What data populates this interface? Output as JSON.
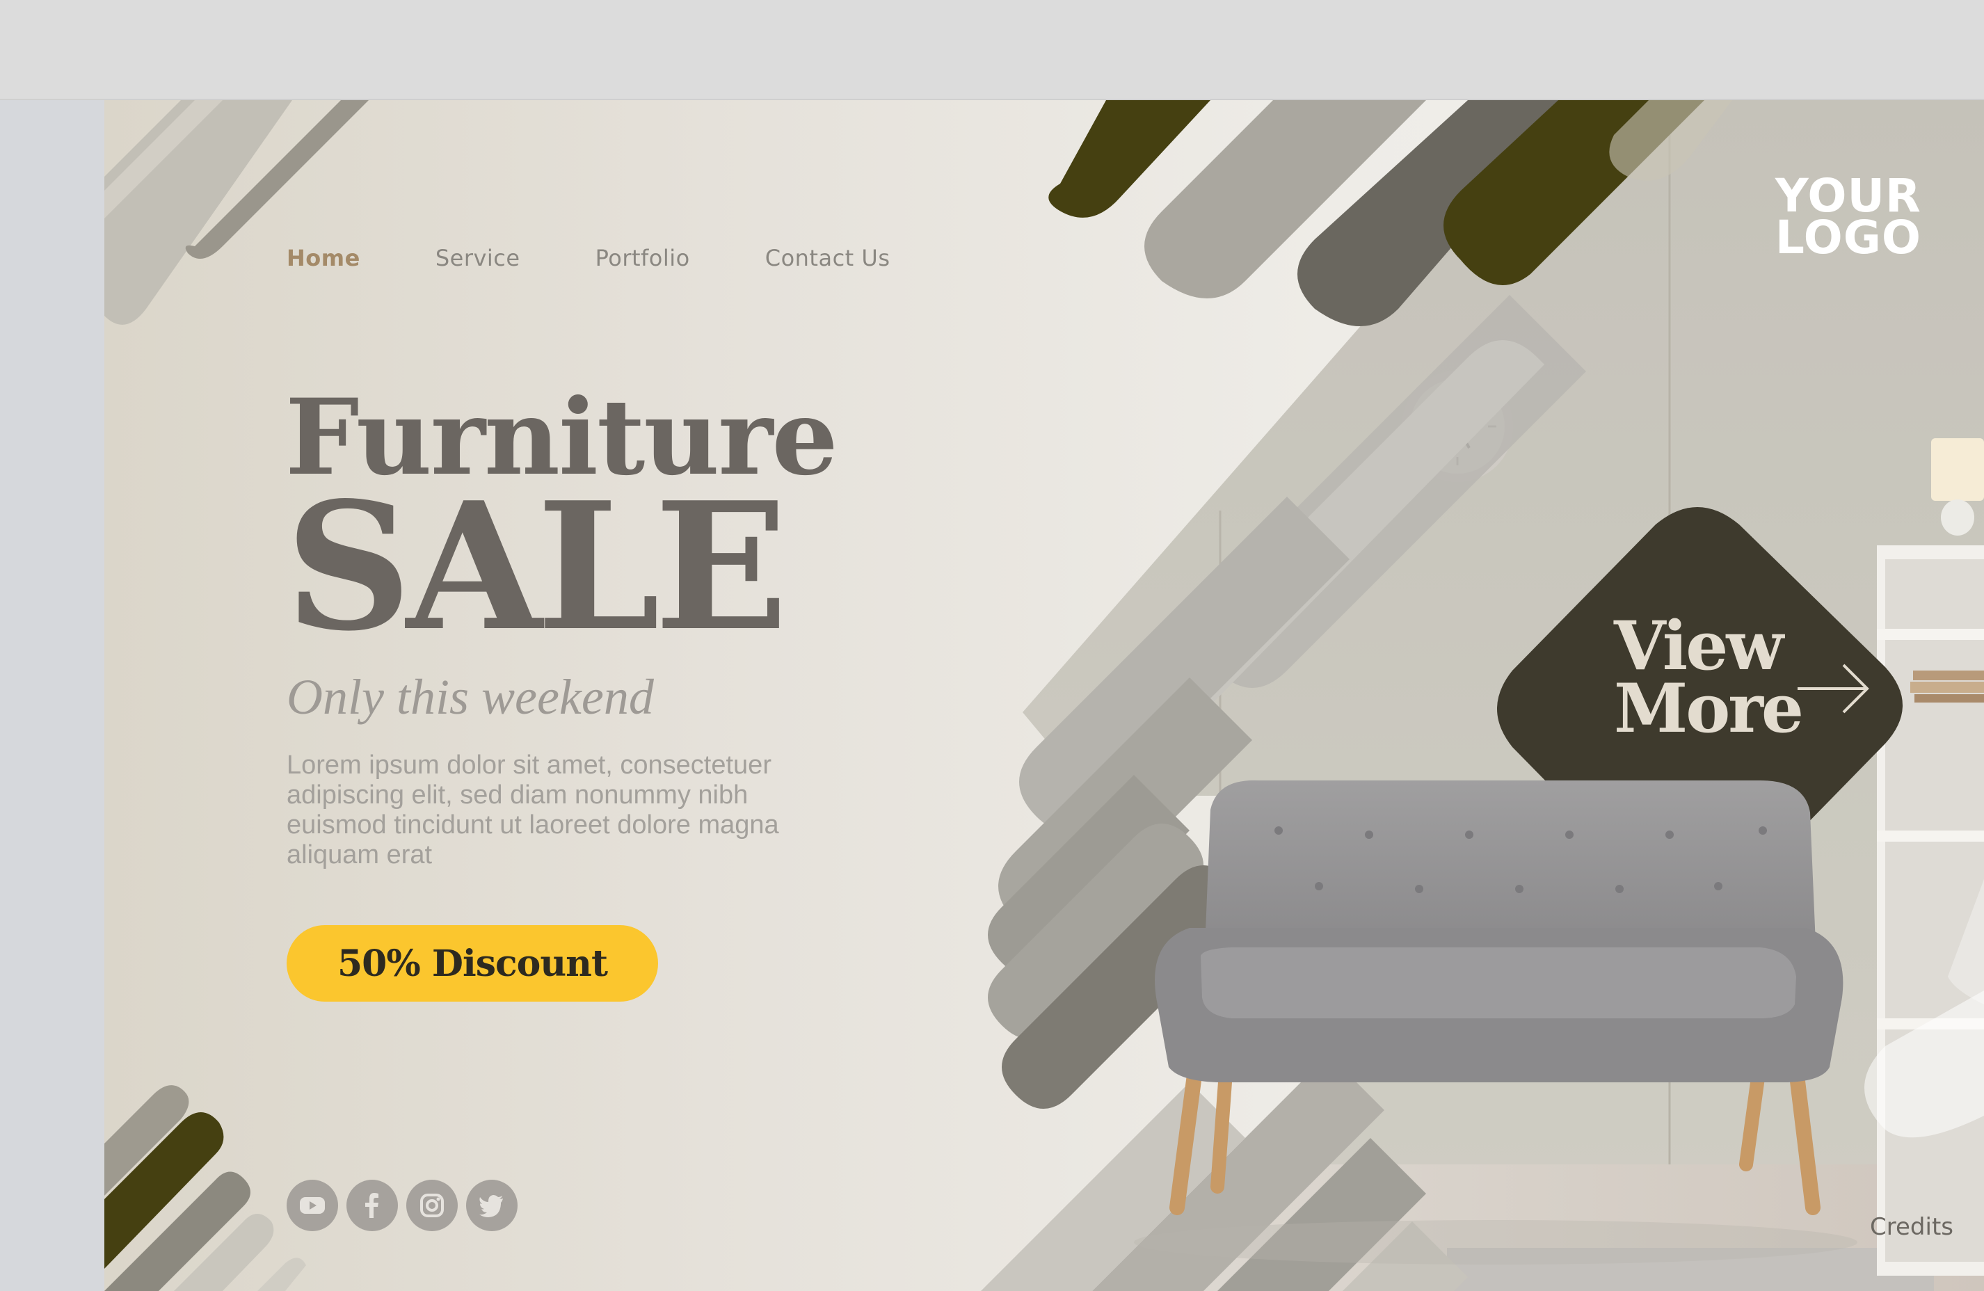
{
  "nav": {
    "items": [
      {
        "label": "Home",
        "active": true
      },
      {
        "label": "Service",
        "active": false
      },
      {
        "label": "Portfolio",
        "active": false
      },
      {
        "label": "Contact Us",
        "active": false
      }
    ]
  },
  "hero": {
    "title_line1": "Furniture",
    "title_line2": "SALE",
    "subtitle": "Only this weekend",
    "body": "Lorem ipsum dolor sit amet, consectetuer adipiscing elit, sed diam nonummy nibh euismod tincidunt ut laoreet dolore magna aliquam erat",
    "cta_label": "50% Discount"
  },
  "logo": {
    "line1": "YOUR",
    "line2": "LOGO"
  },
  "view_more": {
    "line1": "View",
    "line2": "More"
  },
  "footer": {
    "credits": "Credits"
  },
  "socials": [
    {
      "icon": "youtube-icon"
    },
    {
      "icon": "facebook-icon"
    },
    {
      "icon": "instagram-icon"
    },
    {
      "icon": "twitter-icon"
    }
  ],
  "colors": {
    "olive": "#454011",
    "taupe": "#6b6661",
    "warm_gray": "#a8a59e",
    "accent_yellow": "#fbc62e",
    "active_nav": "#a48a68",
    "view_more_bg": "#3e3a2d"
  }
}
